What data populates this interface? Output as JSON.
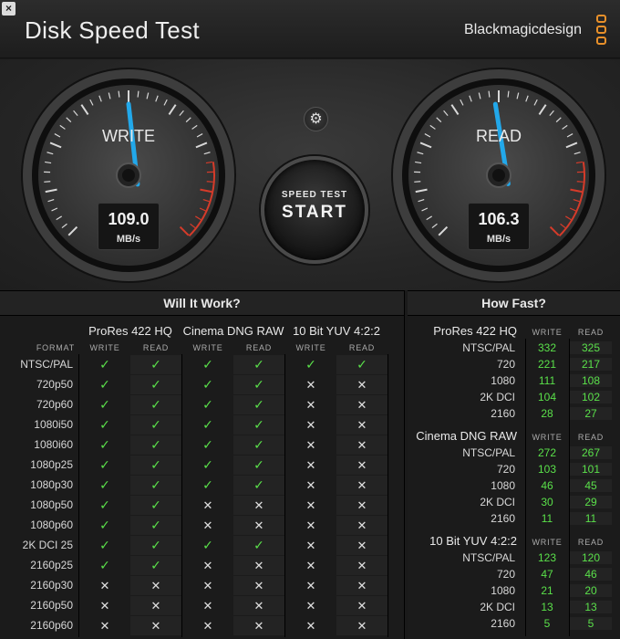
{
  "window": {
    "close_label": "×",
    "title": "Disk Speed Test",
    "brand": "Blackmagicdesign"
  },
  "colors": {
    "needle": "#22a8ea",
    "check": "#5ae04a",
    "redzone": "#d53b2a",
    "brand_orange": "#e8902a"
  },
  "gauges": {
    "write": {
      "title": "WRITE",
      "value": "109.0",
      "unit": "MB/s",
      "needle_fraction": 0.5
    },
    "read": {
      "title": "READ",
      "value": "106.3",
      "unit": "MB/s",
      "needle_fraction": 0.49
    }
  },
  "controls": {
    "settings_icon": "gear-icon",
    "settings_glyph": "⚙",
    "start_small": "SPEED TEST",
    "start_big": "START"
  },
  "will_it_work": {
    "header": "Will It Work?",
    "format_label": "FORMAT",
    "groups": [
      "ProRes 422 HQ",
      "Cinema DNG RAW",
      "10 Bit YUV 4:2:2"
    ],
    "col_write": "WRITE",
    "col_read": "READ",
    "rows": [
      {
        "format": "NTSC/PAL",
        "cells": [
          1,
          1,
          1,
          1,
          1,
          1
        ]
      },
      {
        "format": "720p50",
        "cells": [
          1,
          1,
          1,
          1,
          0,
          0
        ]
      },
      {
        "format": "720p60",
        "cells": [
          1,
          1,
          1,
          1,
          0,
          0
        ]
      },
      {
        "format": "1080i50",
        "cells": [
          1,
          1,
          1,
          1,
          0,
          0
        ]
      },
      {
        "format": "1080i60",
        "cells": [
          1,
          1,
          1,
          1,
          0,
          0
        ]
      },
      {
        "format": "1080p25",
        "cells": [
          1,
          1,
          1,
          1,
          0,
          0
        ]
      },
      {
        "format": "1080p30",
        "cells": [
          1,
          1,
          1,
          1,
          0,
          0
        ]
      },
      {
        "format": "1080p50",
        "cells": [
          1,
          1,
          0,
          0,
          0,
          0
        ]
      },
      {
        "format": "1080p60",
        "cells": [
          1,
          1,
          0,
          0,
          0,
          0
        ]
      },
      {
        "format": "2K DCI 25",
        "cells": [
          1,
          1,
          1,
          1,
          0,
          0
        ]
      },
      {
        "format": "2160p25",
        "cells": [
          1,
          1,
          0,
          0,
          0,
          0
        ]
      },
      {
        "format": "2160p30",
        "cells": [
          0,
          0,
          0,
          0,
          0,
          0
        ]
      },
      {
        "format": "2160p50",
        "cells": [
          0,
          0,
          0,
          0,
          0,
          0
        ]
      },
      {
        "format": "2160p60",
        "cells": [
          0,
          0,
          0,
          0,
          0,
          0
        ]
      }
    ],
    "check_glyph": "✓",
    "cross_glyph": "✕"
  },
  "how_fast": {
    "header": "How Fast?",
    "col_write": "WRITE",
    "col_read": "READ",
    "groups": [
      {
        "name": "ProRes 422 HQ",
        "rows": [
          {
            "label": "NTSC/PAL",
            "write": "332",
            "read": "325"
          },
          {
            "label": "720",
            "write": "221",
            "read": "217"
          },
          {
            "label": "1080",
            "write": "111",
            "read": "108"
          },
          {
            "label": "2K DCI",
            "write": "104",
            "read": "102"
          },
          {
            "label": "2160",
            "write": "28",
            "read": "27"
          }
        ]
      },
      {
        "name": "Cinema DNG RAW",
        "rows": [
          {
            "label": "NTSC/PAL",
            "write": "272",
            "read": "267"
          },
          {
            "label": "720",
            "write": "103",
            "read": "101"
          },
          {
            "label": "1080",
            "write": "46",
            "read": "45"
          },
          {
            "label": "2K DCI",
            "write": "30",
            "read": "29"
          },
          {
            "label": "2160",
            "write": "11",
            "read": "11"
          }
        ]
      },
      {
        "name": "10 Bit YUV 4:2:2",
        "rows": [
          {
            "label": "NTSC/PAL",
            "write": "123",
            "read": "120"
          },
          {
            "label": "720",
            "write": "47",
            "read": "46"
          },
          {
            "label": "1080",
            "write": "21",
            "read": "20"
          },
          {
            "label": "2K DCI",
            "write": "13",
            "read": "13"
          },
          {
            "label": "2160",
            "write": "5",
            "read": "5"
          }
        ]
      }
    ]
  }
}
